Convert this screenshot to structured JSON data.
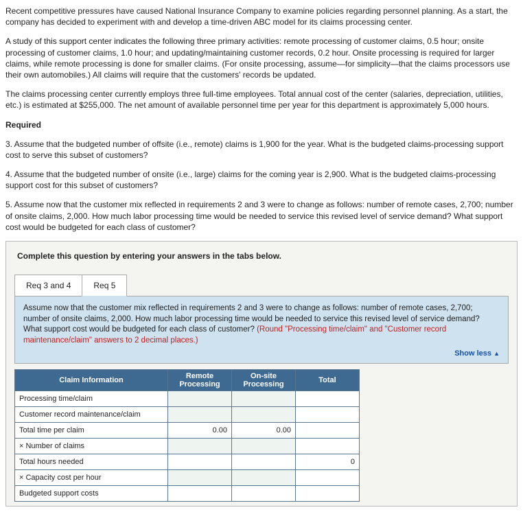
{
  "problem": {
    "p1": "Recent competitive pressures have caused National Insurance Company to examine policies regarding personnel planning. As a start, the company has decided to experiment with and develop a time-driven ABC model for its claims processing center.",
    "p2": "A study of this support center indicates the following three primary activities: remote processing of customer claims, 0.5 hour; onsite processing of customer claims, 1.0 hour; and updating/maintaining customer records, 0.2 hour. Onsite processing is required for larger claims, while remote processing is done for smaller claims. (For onsite processing, assume—for simplicity—that the claims processors use their own automobiles.) All claims will require that the customers' records be updated.",
    "p3": "The claims processing center currently employs three full-time employees. Total annual cost of the center (salaries, depreciation, utilities, etc.) is estimated at $255,000. The net amount of available personnel time per year for this department is approximately 5,000 hours.",
    "req_header": "Required",
    "q3": "3. Assume that the budgeted number of offsite (i.e., remote) claims is 1,900 for the year. What is the budgeted claims-processing support cost to serve this subset of customers?",
    "q4": "4. Assume that the budgeted number of onsite (i.e., large) claims for the coming year is 2,900. What is the budgeted claims-processing support cost for this subset of customers?",
    "q5": "5. Assume now that the customer mix reflected in requirements 2 and 3 were to change as follows: number of remote cases, 2,700; number of onsite claims, 2,000. How much labor processing time would be needed to service this revised level of service demand? What support cost would be budgeted for each class of customer?"
  },
  "box": {
    "instruction": "Complete this question by entering your answers in the tabs below.",
    "tabs": {
      "t1": "Req 3 and 4",
      "t2": "Req 5"
    },
    "panel_text": "Assume now that the customer mix reflected in requirements 2 and 3 were to change as follows: number of remote cases, 2,700; number of onsite claims, 2,000. How much labor processing time would be needed to service this revised level of service demand? What support cost would be budgeted for each class of customer? ",
    "round_note": "(Round \"Processing time/claim\" and \"Customer record maintenance/claim\" answers to 2 decimal places.)",
    "show_less": "Show less"
  },
  "table": {
    "headers": {
      "c0": "Claim Information",
      "c1": "Remote Processing",
      "c2": "On-site Processing",
      "c3": "Total"
    },
    "rows": {
      "r0": "Processing time/claim",
      "r1": "Customer record maintenance/claim",
      "r2": "Total time per claim",
      "r3": "× Number of claims",
      "r4": "Total hours needed",
      "r5": "× Capacity cost per hour",
      "r6": "Budgeted support costs"
    },
    "values": {
      "r2c1": "0.00",
      "r2c2": "0.00",
      "r4c3": "0"
    }
  }
}
